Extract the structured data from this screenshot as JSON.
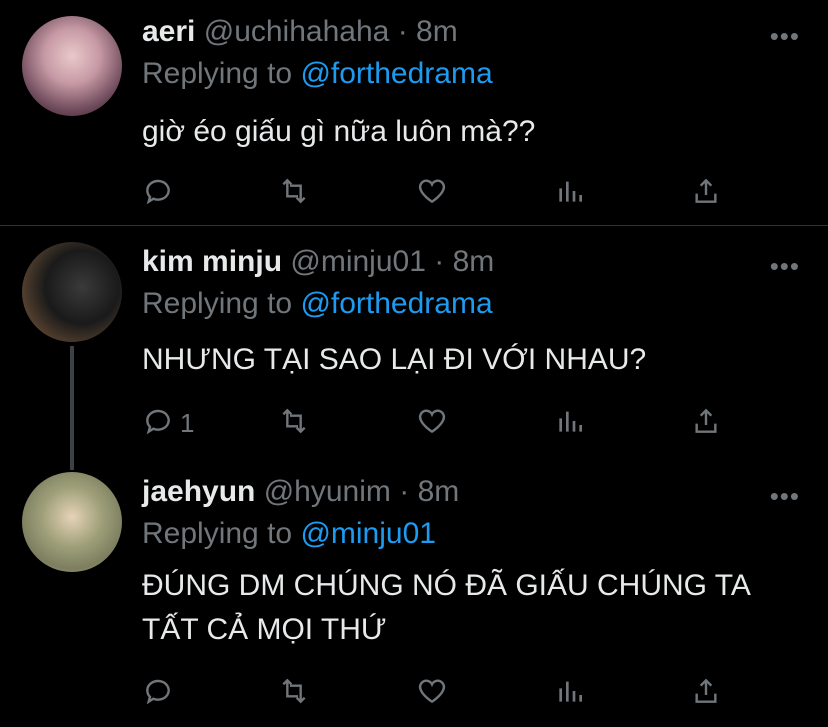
{
  "tweets": [
    {
      "name": "aeri",
      "handle": "@uchihahaha",
      "time": "8m",
      "replying_label": "Replying to",
      "replying_to": "@forthedrama",
      "text": "giờ éo giấu gì nữa luôn mà??",
      "reply_count": "",
      "avatar_icon": "avatar-photo"
    },
    {
      "name": "kim minju",
      "handle": "@minju01",
      "time": "8m",
      "replying_label": "Replying to",
      "replying_to": "@forthedrama",
      "text": "NHƯNG TẠI SAO LẠI ĐI VỚI NHAU?",
      "reply_count": "1",
      "avatar_icon": "avatar-photo"
    },
    {
      "name": "jaehyun",
      "handle": "@hyunim",
      "time": "8m",
      "replying_label": "Replying to",
      "replying_to": "@minju01",
      "text": "ĐÚNG DM CHÚNG NÓ ĐÃ GIẤU CHÚNG TA TẤT CẢ MỌI THỨ",
      "reply_count": "",
      "avatar_icon": "avatar-photo"
    }
  ],
  "separator": "·",
  "more_icon": "•••",
  "colors": {
    "background": "#000000",
    "text": "#e7e9ea",
    "muted": "#71767b",
    "mention": "#1d9bf0",
    "divider": "#2f3336"
  },
  "action_icons": [
    "reply-icon",
    "retweet-icon",
    "like-icon",
    "analytics-icon",
    "share-icon"
  ]
}
